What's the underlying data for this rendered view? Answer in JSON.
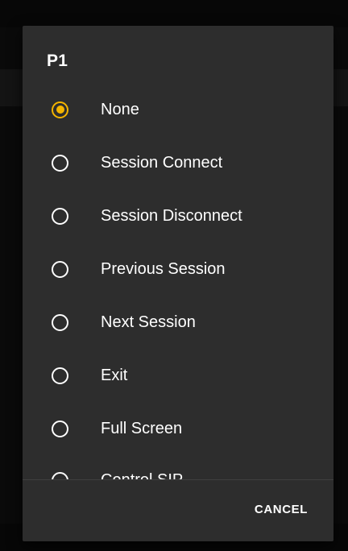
{
  "dialog": {
    "title": "P1",
    "selected_index": 0,
    "options": [
      {
        "label": "None",
        "selected": true
      },
      {
        "label": "Session Connect",
        "selected": false
      },
      {
        "label": "Session Disconnect",
        "selected": false
      },
      {
        "label": "Previous Session",
        "selected": false
      },
      {
        "label": "Next Session",
        "selected": false
      },
      {
        "label": "Exit",
        "selected": false
      },
      {
        "label": "Full Screen",
        "selected": false
      },
      {
        "label": "Control SIP",
        "selected": false
      }
    ],
    "cancel_label": "CANCEL"
  },
  "colors": {
    "accent": "#f4b400",
    "dialog_background": "#2d2d2d",
    "text": "#ffffff"
  }
}
